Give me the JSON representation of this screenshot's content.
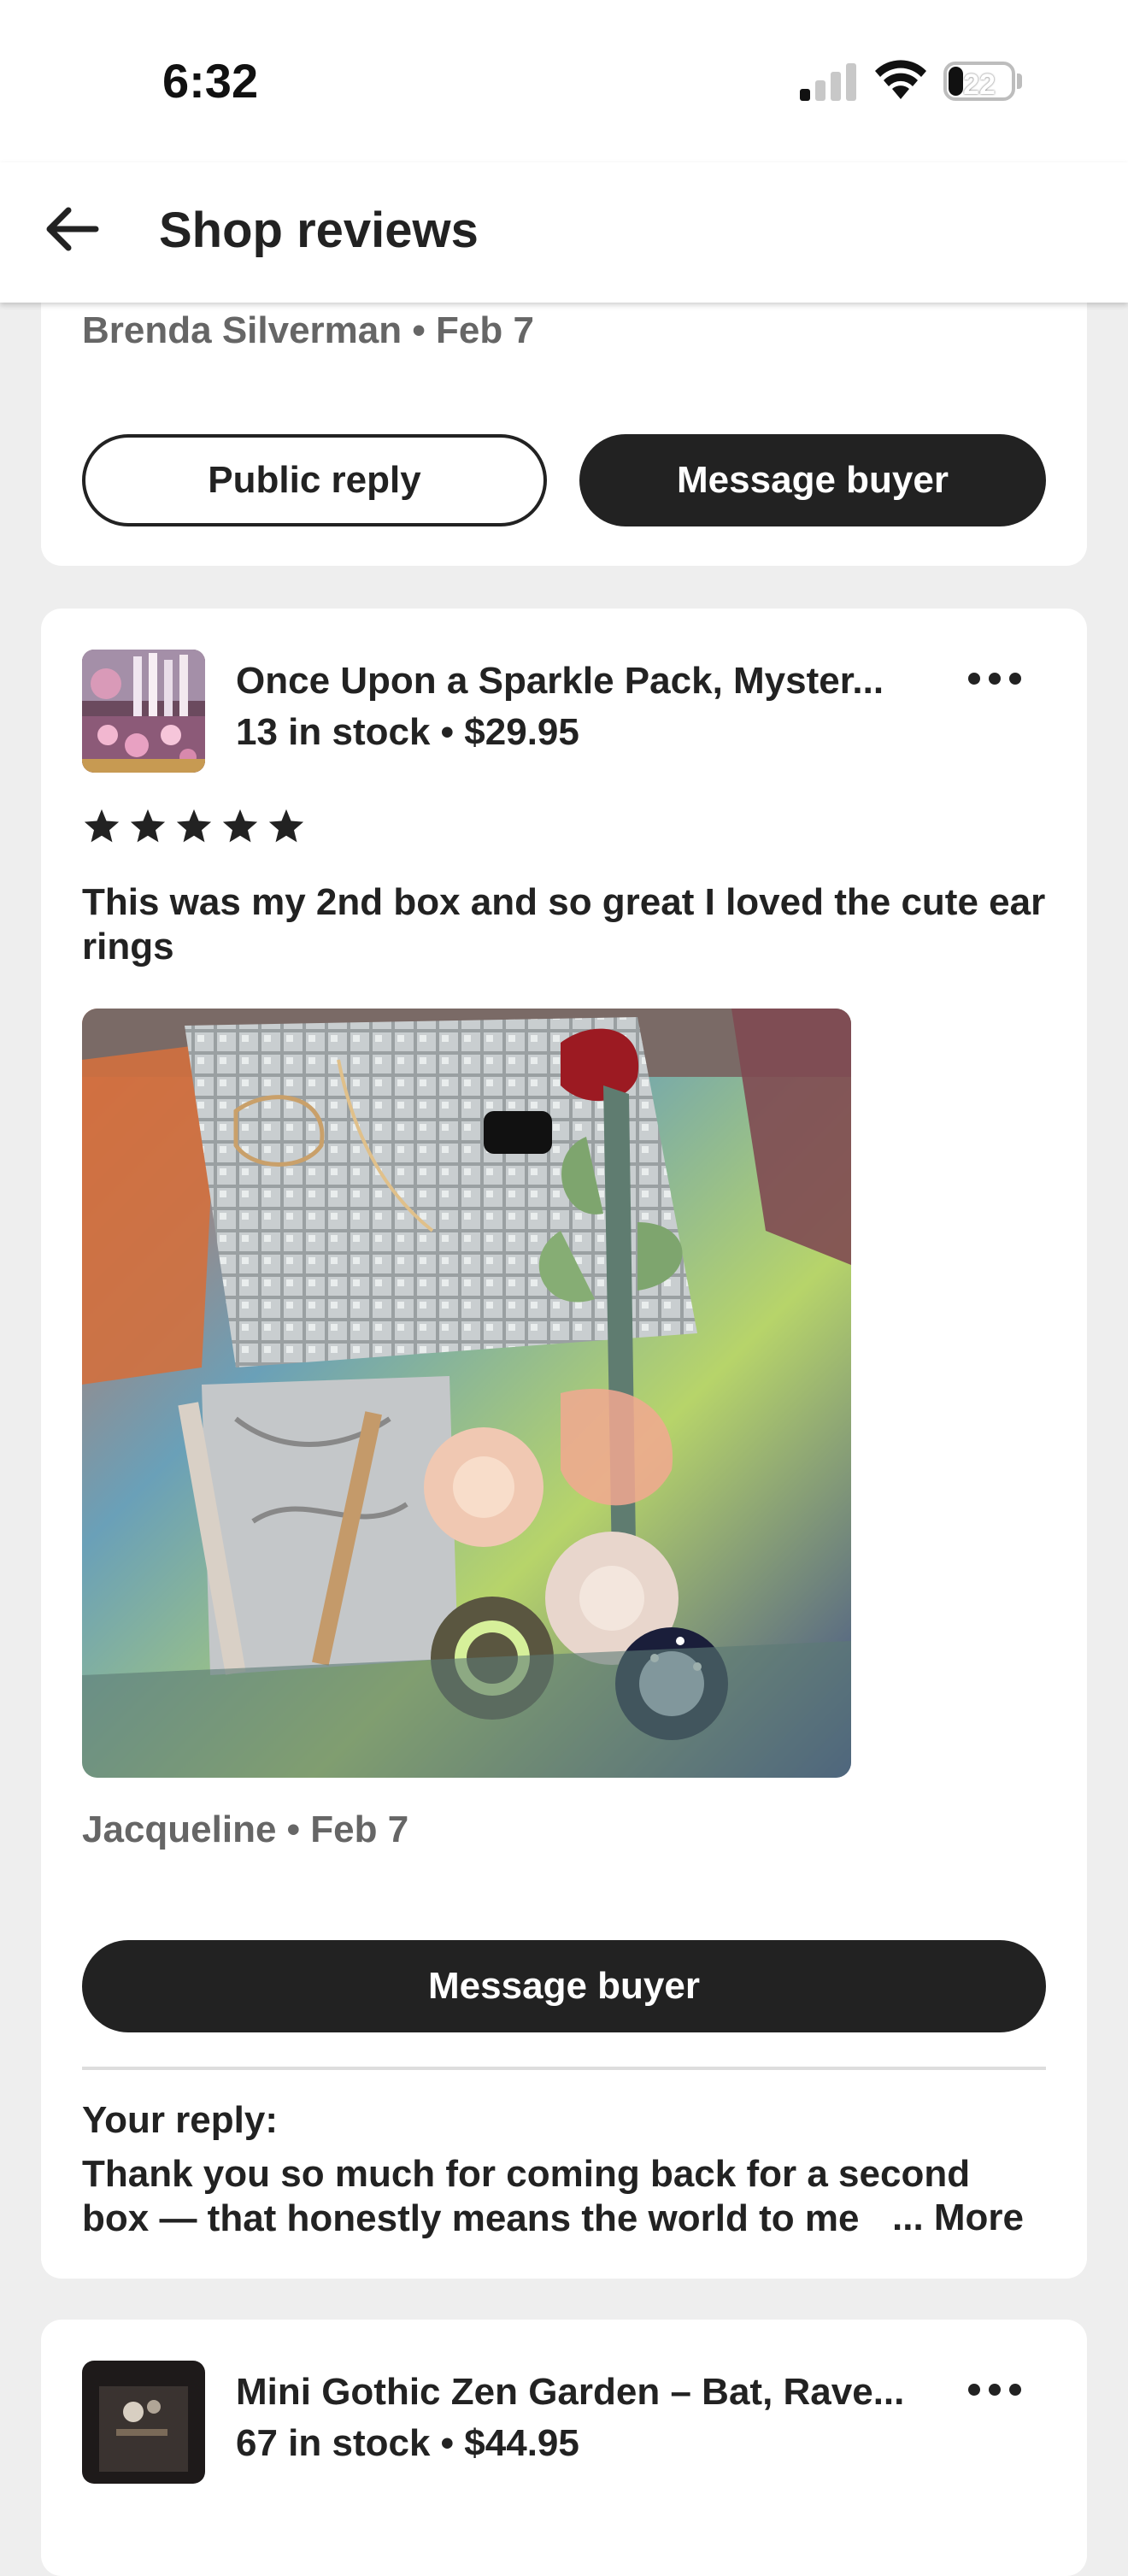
{
  "status_bar": {
    "time": "6:32",
    "battery_level": "22",
    "battery_fraction": 0.22,
    "signal_bars_active": 1
  },
  "header": {
    "title": "Shop reviews",
    "back_icon": "arrow-left-icon"
  },
  "prev_review": {
    "author_date": "Brenda Silverman • Feb 7",
    "public_reply_label": "Public reply",
    "message_buyer_label": "Message buyer"
  },
  "review": {
    "listing_title": "Once Upon a Sparkle Pack, Myster...",
    "listing_sub": "13 in stock • $29.95",
    "rating": 5,
    "text": "This was my 2nd box and so great I loved the cute ear rings",
    "author_date": "Jacqueline • Feb 7",
    "message_buyer_label": "Message buyer",
    "reply_label": "Your reply:",
    "reply_text": "Thank you so much for coming back for a second box — that honestly means the world to me",
    "reply_more": "... More"
  },
  "next_review": {
    "listing_title": "Mini Gothic Zen Garden – Bat, Rave...",
    "listing_sub": "67 in stock • $44.95"
  },
  "colors": {
    "background": "#eeeeee",
    "card": "#ffffff",
    "text": "#222222",
    "muted": "#666666",
    "button_dark": "#222222"
  }
}
